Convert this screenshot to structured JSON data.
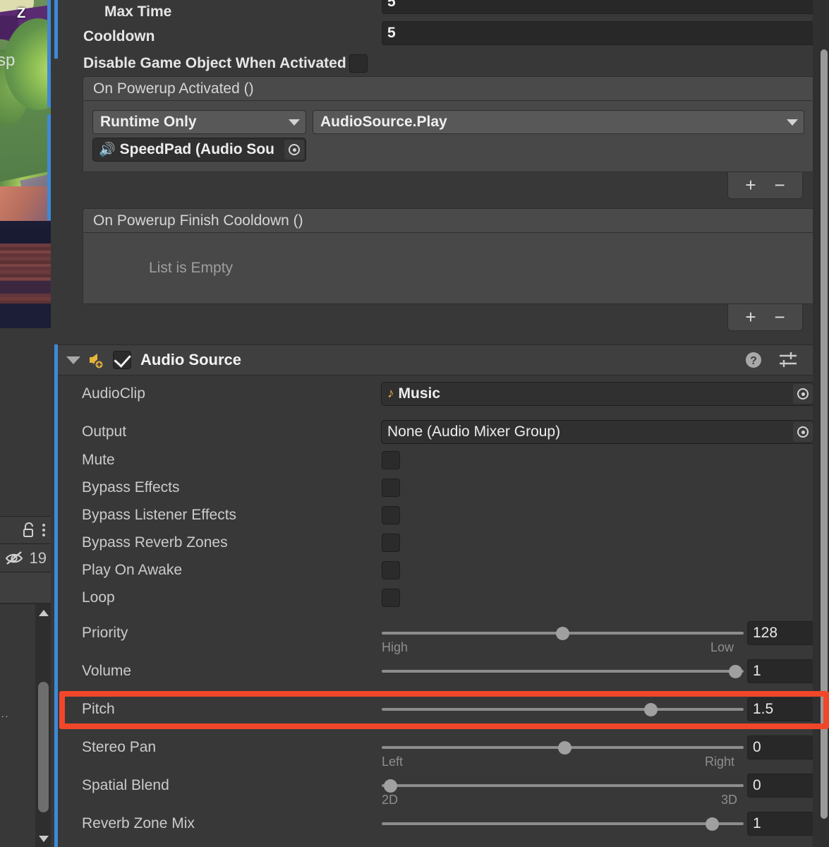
{
  "app": {
    "panel": "Inspector"
  },
  "scene_strip": {
    "gizmo_axis_label": "Z",
    "object_label_fragment": "sp"
  },
  "hierarchy_tail": {
    "lock_icon": "lock-icon",
    "menu_icon": "kebab-menu-icon",
    "hidden_objects_icon": "eye-crossed-icon",
    "hidden_objects_count": "19",
    "truncated_item": "..",
    "scroll_up_icon": "scroll-up-arrow-icon",
    "scroll_down_icon": "scroll-down-arrow-icon"
  },
  "powerup_component": {
    "fields": [
      {
        "label": "Max Time",
        "value": "5",
        "indented": true
      },
      {
        "label": "Cooldown",
        "value": "5",
        "indented": false
      }
    ],
    "toggle_field": {
      "label": "Disable Game Object When Activated",
      "checked": false
    },
    "events": [
      {
        "title": "On Powerup Activated ()",
        "empty": false,
        "empty_text": "",
        "entry": {
          "call_state": "Runtime Only",
          "function": "AudioSource.Play",
          "target_object": "SpeedPad (Audio Sou",
          "target_icon": "audio-source-icon"
        },
        "add_label": "+",
        "remove_label": "−"
      },
      {
        "title": "On Powerup Finish Cooldown ()",
        "empty": true,
        "empty_text": "List is Empty",
        "entry": null,
        "add_label": "+",
        "remove_label": "−"
      }
    ]
  },
  "audio_source": {
    "header": {
      "title": "Audio Source",
      "enabled": true,
      "foldout_open": true,
      "icon": "audio-source-icon",
      "help_icon": "help-icon",
      "preset_icon": "preset-sliders-icon",
      "menu_icon": "kebab-menu-icon"
    },
    "object_fields": [
      {
        "label": "AudioClip",
        "value": "Music",
        "icon": "music-note-icon",
        "picker": "object-picker-icon"
      },
      {
        "label": "Output",
        "value": "None (Audio Mixer Group)",
        "icon": "",
        "picker": "object-picker-icon"
      }
    ],
    "toggles": [
      {
        "label": "Mute",
        "checked": false
      },
      {
        "label": "Bypass Effects",
        "checked": false
      },
      {
        "label": "Bypass Listener Effects",
        "checked": false
      },
      {
        "label": "Bypass Reverb Zones",
        "checked": false
      },
      {
        "label": "Play On Awake",
        "checked": false
      },
      {
        "label": "Loop",
        "checked": false
      }
    ],
    "sliders": [
      {
        "label": "Priority",
        "value": "128",
        "fraction": 0.492,
        "min_label": "High",
        "max_label": "Low",
        "highlighted": false
      },
      {
        "label": "Volume",
        "value": "1",
        "fraction": 0.972,
        "min_label": "",
        "max_label": "",
        "highlighted": false
      },
      {
        "label": "Pitch",
        "value": "1.5",
        "fraction": 0.735,
        "min_label": "",
        "max_label": "",
        "highlighted": true
      },
      {
        "label": "Stereo Pan",
        "value": "0",
        "fraction": 0.498,
        "min_label": "Left",
        "max_label": "Right",
        "highlighted": false
      },
      {
        "label": "Spatial Blend",
        "value": "0",
        "fraction": 0.018,
        "min_label": "2D",
        "max_label": "3D",
        "highlighted": false
      },
      {
        "label": "Reverb Zone Mix",
        "value": "1",
        "fraction": 0.912,
        "min_label": "",
        "max_label": "",
        "highlighted": false
      }
    ]
  },
  "colors": {
    "panel_bg": "#383838",
    "header_bg": "#3f3f3f",
    "field_bg": "#282828",
    "event_bg": "#484848",
    "selection_blue": "#3d8ad8",
    "highlight_red": "#f0472a",
    "audio_yellow": "#e8b33a",
    "text_primary": "#cbcbcb"
  }
}
